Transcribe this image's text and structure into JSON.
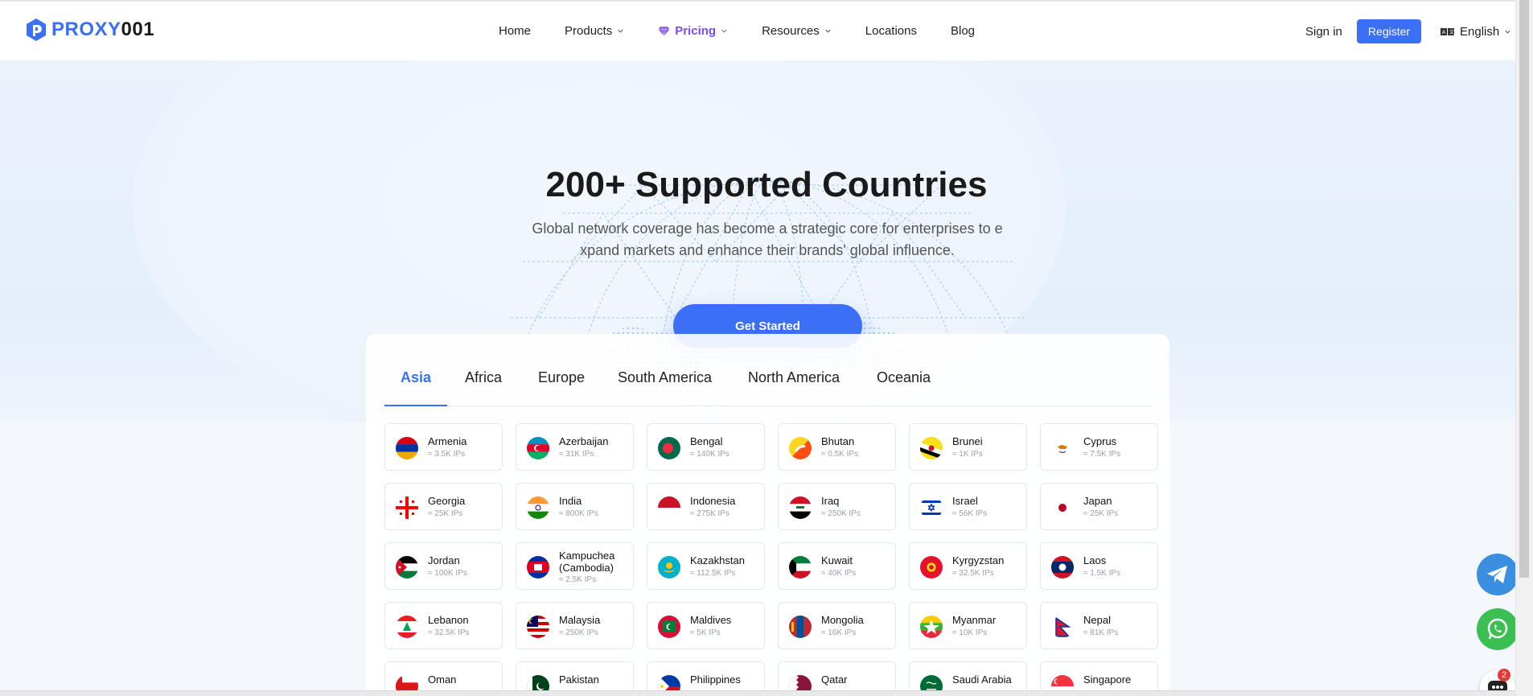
{
  "brand": {
    "logo_blue": "PROXY",
    "logo_dark": "001",
    "accent": "#3b6ff5",
    "pricing_color": "#7b4bf0"
  },
  "nav": {
    "home": "Home",
    "products": "Products",
    "pricing": "Pricing",
    "resources": "Resources",
    "locations": "Locations",
    "blog": "Blog"
  },
  "auth": {
    "signin": "Sign in",
    "register": "Register"
  },
  "language": {
    "label": "English"
  },
  "hero": {
    "title": "200+ Supported Countries",
    "subtitle_line1": "Global network coverage has become a strategic core for enterprises to e",
    "subtitle_line2": "xpand markets and enhance their brands' global influence.",
    "cta": "Get Started"
  },
  "tabs": [
    "Asia",
    "Africa",
    "Europe",
    "South America",
    "North America",
    "Oceania"
  ],
  "active_tab": "Asia",
  "countries": [
    {
      "name": "Armenia",
      "ips": "≈ 3.5K IPs",
      "flag": "armenia"
    },
    {
      "name": "Azerbaijan",
      "ips": "≈ 31K IPs",
      "flag": "azerbaijan"
    },
    {
      "name": "Bengal",
      "ips": "≈ 140K IPs",
      "flag": "bangladesh"
    },
    {
      "name": "Bhutan",
      "ips": "≈ 0.5K IPs",
      "flag": "bhutan"
    },
    {
      "name": "Brunei",
      "ips": "≈ 1K IPs",
      "flag": "brunei"
    },
    {
      "name": "Cyprus",
      "ips": "≈ 7.5K IPs",
      "flag": "cyprus"
    },
    {
      "name": "Georgia",
      "ips": "≈ 25K IPs",
      "flag": "georgia"
    },
    {
      "name": "India",
      "ips": "≈ 800K IPs",
      "flag": "india"
    },
    {
      "name": "Indonesia",
      "ips": "≈ 275K IPs",
      "flag": "indonesia"
    },
    {
      "name": "Iraq",
      "ips": "≈ 250K IPs",
      "flag": "iraq"
    },
    {
      "name": "Israel",
      "ips": "≈ 56K IPs",
      "flag": "israel"
    },
    {
      "name": "Japan",
      "ips": "≈ 25K IPs",
      "flag": "japan"
    },
    {
      "name": "Jordan",
      "ips": "≈ 100K IPs",
      "flag": "jordan"
    },
    {
      "name": "Kampuchea (Cambodia)",
      "ips": "≈ 2.5K IPs",
      "flag": "cambodia"
    },
    {
      "name": "Kazakhstan",
      "ips": "≈ 112.5K IPs",
      "flag": "kazakhstan"
    },
    {
      "name": "Kuwait",
      "ips": "≈ 40K IPs",
      "flag": "kuwait"
    },
    {
      "name": "Kyrgyzstan",
      "ips": "≈ 32.5K IPs",
      "flag": "kyrgyzstan"
    },
    {
      "name": "Laos",
      "ips": "≈ 1.5K IPs",
      "flag": "laos"
    },
    {
      "name": "Lebanon",
      "ips": "≈ 32.5K IPs",
      "flag": "lebanon"
    },
    {
      "name": "Malaysia",
      "ips": "≈ 250K IPs",
      "flag": "malaysia"
    },
    {
      "name": "Maldives",
      "ips": "≈ 5K IPs",
      "flag": "maldives"
    },
    {
      "name": "Mongolia",
      "ips": "≈ 16K IPs",
      "flag": "mongolia"
    },
    {
      "name": "Myanmar",
      "ips": "≈ 10K IPs",
      "flag": "myanmar"
    },
    {
      "name": "Nepal",
      "ips": "≈ 81K IPs",
      "flag": "nepal"
    },
    {
      "name": "Oman",
      "ips": "",
      "flag": "oman"
    },
    {
      "name": "Pakistan",
      "ips": "",
      "flag": "pakistan"
    },
    {
      "name": "Philippines",
      "ips": "",
      "flag": "philippines"
    },
    {
      "name": "Qatar",
      "ips": "",
      "flag": "qatar"
    },
    {
      "name": "Saudi Arabia",
      "ips": "",
      "flag": "saudi-arabia"
    },
    {
      "name": "Singapore",
      "ips": "",
      "flag": "singapore"
    }
  ],
  "chat_badge": "2"
}
